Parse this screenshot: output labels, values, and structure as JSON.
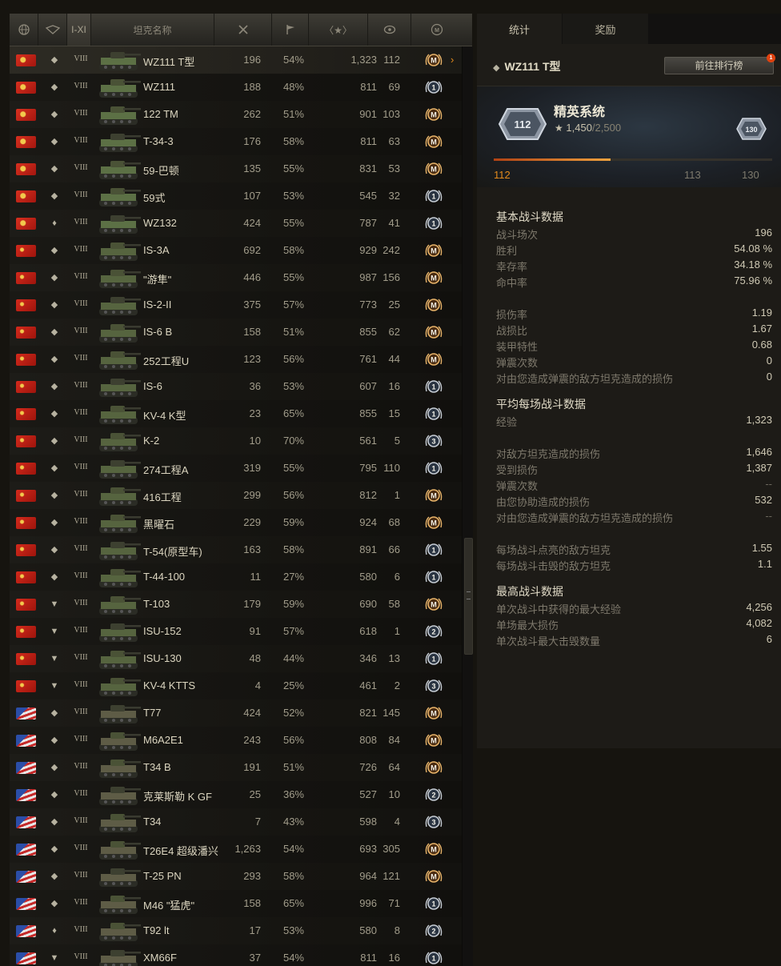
{
  "table": {
    "headers": {
      "nation_icon": "globe-icon",
      "type_icon": "vehicle-type-icon",
      "tier_label": "I-XI",
      "name_label": "坦克名称",
      "battles_icon": "battles-icon",
      "wins_icon": "flag-icon",
      "xp_label": "〈★〉",
      "frags_icon": "target-icon",
      "mastery_icon": "mastery-badge-icon"
    },
    "rows": [
      {
        "nation": "cn",
        "type": "heavy",
        "tier": "VIII",
        "name": "WZ111 T型",
        "battles": "196",
        "wins": "54%",
        "xp": "1,323",
        "frags": "112",
        "mastery": "M",
        "selected": true,
        "arrow": "›"
      },
      {
        "nation": "cn",
        "type": "heavy",
        "tier": "VIII",
        "name": "WZ111",
        "battles": "188",
        "wins": "48%",
        "xp": "811",
        "frags": "69",
        "mastery": "1"
      },
      {
        "nation": "cn",
        "type": "medium",
        "tier": "VIII",
        "name": "122 TM",
        "battles": "262",
        "wins": "51%",
        "xp": "901",
        "frags": "103",
        "mastery": "M"
      },
      {
        "nation": "cn",
        "type": "medium",
        "tier": "VIII",
        "name": "T-34-3",
        "battles": "176",
        "wins": "58%",
        "xp": "811",
        "frags": "63",
        "mastery": "M"
      },
      {
        "nation": "cn",
        "type": "medium",
        "tier": "VIII",
        "name": "59-巴顿",
        "battles": "135",
        "wins": "55%",
        "xp": "831",
        "frags": "53",
        "mastery": "M"
      },
      {
        "nation": "cn",
        "type": "medium",
        "tier": "VIII",
        "name": "59式",
        "battles": "107",
        "wins": "53%",
        "xp": "545",
        "frags": "32",
        "mastery": "1"
      },
      {
        "nation": "cn",
        "type": "light",
        "tier": "VIII",
        "name": "WZ132",
        "battles": "424",
        "wins": "55%",
        "xp": "787",
        "frags": "41",
        "mastery": "1"
      },
      {
        "nation": "su",
        "type": "heavy",
        "tier": "VIII",
        "name": "IS-3A",
        "battles": "692",
        "wins": "58%",
        "xp": "929",
        "frags": "242",
        "mastery": "M"
      },
      {
        "nation": "su",
        "type": "heavy",
        "tier": "VIII",
        "name": "\"游隼\"",
        "battles": "446",
        "wins": "55%",
        "xp": "987",
        "frags": "156",
        "mastery": "M"
      },
      {
        "nation": "su",
        "type": "heavy",
        "tier": "VIII",
        "name": "IS-2-II",
        "battles": "375",
        "wins": "57%",
        "xp": "773",
        "frags": "25",
        "mastery": "M"
      },
      {
        "nation": "su",
        "type": "heavy",
        "tier": "VIII",
        "name": "IS-6 B",
        "battles": "158",
        "wins": "51%",
        "xp": "855",
        "frags": "62",
        "mastery": "M"
      },
      {
        "nation": "su",
        "type": "heavy",
        "tier": "VIII",
        "name": "252工程U",
        "battles": "123",
        "wins": "56%",
        "xp": "761",
        "frags": "44",
        "mastery": "M"
      },
      {
        "nation": "su",
        "type": "heavy",
        "tier": "VIII",
        "name": "IS-6",
        "battles": "36",
        "wins": "53%",
        "xp": "607",
        "frags": "16",
        "mastery": "1"
      },
      {
        "nation": "su",
        "type": "heavy",
        "tier": "VIII",
        "name": "KV-4 K型",
        "battles": "23",
        "wins": "65%",
        "xp": "855",
        "frags": "15",
        "mastery": "1"
      },
      {
        "nation": "su",
        "type": "heavy",
        "tier": "VIII",
        "name": "K-2",
        "battles": "10",
        "wins": "70%",
        "xp": "561",
        "frags": "5",
        "mastery": "3"
      },
      {
        "nation": "su",
        "type": "medium",
        "tier": "VIII",
        "name": "274工程A",
        "battles": "319",
        "wins": "55%",
        "xp": "795",
        "frags": "110",
        "mastery": "1"
      },
      {
        "nation": "su",
        "type": "medium",
        "tier": "VIII",
        "name": "416工程",
        "battles": "299",
        "wins": "56%",
        "xp": "812",
        "frags": "1",
        "mastery": "M"
      },
      {
        "nation": "su",
        "type": "medium",
        "tier": "VIII",
        "name": "黑曜石",
        "battles": "229",
        "wins": "59%",
        "xp": "924",
        "frags": "68",
        "mastery": "M"
      },
      {
        "nation": "su",
        "type": "medium",
        "tier": "VIII",
        "name": "T-54(原型车)",
        "battles": "163",
        "wins": "58%",
        "xp": "891",
        "frags": "66",
        "mastery": "1"
      },
      {
        "nation": "su",
        "type": "medium",
        "tier": "VIII",
        "name": "T-44-100",
        "battles": "11",
        "wins": "27%",
        "xp": "580",
        "frags": "6",
        "mastery": "1"
      },
      {
        "nation": "su",
        "type": "td",
        "tier": "VIII",
        "name": "T-103",
        "battles": "179",
        "wins": "59%",
        "xp": "690",
        "frags": "58",
        "mastery": "M"
      },
      {
        "nation": "su",
        "type": "td",
        "tier": "VIII",
        "name": "ISU-152",
        "battles": "91",
        "wins": "57%",
        "xp": "618",
        "frags": "1",
        "mastery": "2"
      },
      {
        "nation": "su",
        "type": "td",
        "tier": "VIII",
        "name": "ISU-130",
        "battles": "48",
        "wins": "44%",
        "xp": "346",
        "frags": "13",
        "mastery": "1"
      },
      {
        "nation": "su",
        "type": "td",
        "tier": "VIII",
        "name": "KV-4 KTTS",
        "battles": "4",
        "wins": "25%",
        "xp": "461",
        "frags": "2",
        "mastery": "3"
      },
      {
        "nation": "us",
        "type": "heavy",
        "tier": "VIII",
        "name": "T77",
        "battles": "424",
        "wins": "52%",
        "xp": "821",
        "frags": "145",
        "mastery": "M"
      },
      {
        "nation": "us",
        "type": "heavy",
        "tier": "VIII",
        "name": "M6A2E1",
        "battles": "243",
        "wins": "56%",
        "xp": "808",
        "frags": "84",
        "mastery": "M"
      },
      {
        "nation": "us",
        "type": "heavy",
        "tier": "VIII",
        "name": "T34 B",
        "battles": "191",
        "wins": "51%",
        "xp": "726",
        "frags": "64",
        "mastery": "M"
      },
      {
        "nation": "us",
        "type": "heavy",
        "tier": "VIII",
        "name": "克莱斯勒 K GF",
        "battles": "25",
        "wins": "36%",
        "xp": "527",
        "frags": "10",
        "mastery": "2"
      },
      {
        "nation": "us",
        "type": "heavy",
        "tier": "VIII",
        "name": "T34",
        "battles": "7",
        "wins": "43%",
        "xp": "598",
        "frags": "4",
        "mastery": "3"
      },
      {
        "nation": "us",
        "type": "medium",
        "tier": "VIII",
        "name": "T26E4 超级潘兴",
        "battles": "1,263",
        "wins": "54%",
        "xp": "693",
        "frags": "305",
        "mastery": "M"
      },
      {
        "nation": "us",
        "type": "medium",
        "tier": "VIII",
        "name": "T-25 PN",
        "battles": "293",
        "wins": "58%",
        "xp": "964",
        "frags": "121",
        "mastery": "M"
      },
      {
        "nation": "us",
        "type": "medium",
        "tier": "VIII",
        "name": "M46 \"猛虎\"",
        "battles": "158",
        "wins": "65%",
        "xp": "996",
        "frags": "71",
        "mastery": "1"
      },
      {
        "nation": "us",
        "type": "light",
        "tier": "VIII",
        "name": "T92 lt",
        "battles": "17",
        "wins": "53%",
        "xp": "580",
        "frags": "8",
        "mastery": "2"
      },
      {
        "nation": "us",
        "type": "td",
        "tier": "VIII",
        "name": "XM66F",
        "battles": "37",
        "wins": "54%",
        "xp": "811",
        "frags": "16",
        "mastery": "1"
      }
    ]
  },
  "panel": {
    "tabs": [
      "统计",
      "奖励"
    ],
    "tank_name": "WZ111 T型",
    "rank_button": "前往排行榜",
    "rank_badge": "1",
    "elite": {
      "title": "精英系统",
      "star": "★",
      "xp_current": "1,450",
      "xp_max": "/2,500",
      "level_current": "112",
      "level_next": "113",
      "level_max": "130",
      "badge_current": "112",
      "badge_max": "130",
      "progress": 0.42
    },
    "sections": [
      {
        "title": "基本战斗数据",
        "rows": [
          {
            "label": "战斗场次",
            "value": "196"
          },
          {
            "label": "胜利",
            "value": "54.08 %"
          },
          {
            "label": "幸存率",
            "value": "34.18 %"
          },
          {
            "label": "命中率",
            "value": "75.96 %"
          },
          {
            "label": "",
            "value": ""
          },
          {
            "label": "损伤率",
            "value": "1.19"
          },
          {
            "label": "战损比",
            "value": "1.67"
          },
          {
            "label": "装甲特性",
            "value": "0.68"
          },
          {
            "label": "弹震次数",
            "value": "0"
          },
          {
            "label": "对由您造成弹震的敌方坦克造成的损伤",
            "value": "0"
          }
        ]
      },
      {
        "title": "平均每场战斗数据",
        "rows": [
          {
            "label": "经验",
            "value": "1,323"
          },
          {
            "label": "",
            "value": ""
          },
          {
            "label": "对敌方坦克造成的损伤",
            "value": "1,646"
          },
          {
            "label": "受到损伤",
            "value": "1,387"
          },
          {
            "label": "弹震次数",
            "value": "--"
          },
          {
            "label": "由您协助造成的损伤",
            "value": "532"
          },
          {
            "label": "对由您造成弹震的敌方坦克造成的损伤",
            "value": "--"
          },
          {
            "label": "",
            "value": ""
          },
          {
            "label": "每场战斗点亮的敌方坦克",
            "value": "1.55"
          },
          {
            "label": "每场战斗击毁的敌方坦克",
            "value": "1.1"
          }
        ]
      },
      {
        "title": "最高战斗数据",
        "rows": [
          {
            "label": "单次战斗中获得的最大经验",
            "value": "4,256"
          },
          {
            "label": "单场最大损伤",
            "value": "4,082"
          },
          {
            "label": "单次战斗最大击毁数量",
            "value": "6"
          }
        ]
      }
    ]
  },
  "colors": {
    "accent": "#e38a1c",
    "gold": "#e9b46a",
    "silver": "#c7cdd5"
  }
}
